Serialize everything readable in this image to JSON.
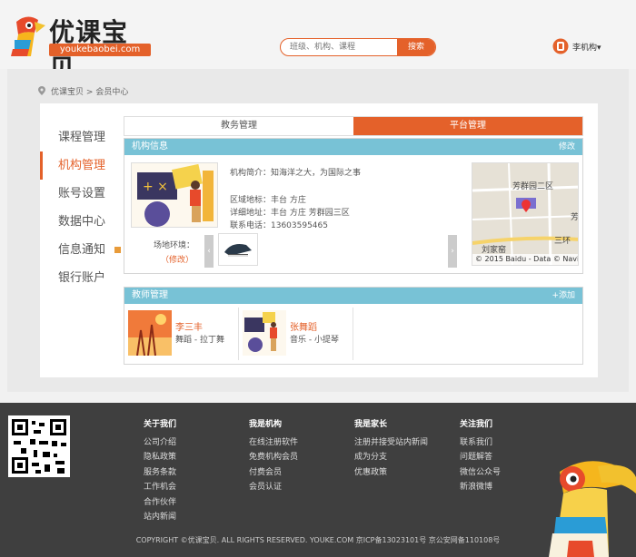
{
  "header": {
    "logo_title": "优课宝贝",
    "logo_subtitle": "youkebaobei.com",
    "search_placeholder": "班级、机构、课程",
    "search_button": "搜索",
    "user_name": "李机构▾"
  },
  "breadcrumb": {
    "home": "优课宝贝",
    "separator": ">",
    "current": "会员中心"
  },
  "sidebar": {
    "items": [
      {
        "label": "课程管理"
      },
      {
        "label": "机构管理"
      },
      {
        "label": "账号设置"
      },
      {
        "label": "数据中心"
      },
      {
        "label": "信息通知"
      },
      {
        "label": "银行账户"
      }
    ],
    "active_index": 1
  },
  "tabs": {
    "items": [
      {
        "label": "教务管理"
      },
      {
        "label": "平台管理"
      }
    ],
    "active_index": 1
  },
  "org_info": {
    "title": "机构信息",
    "edit": "修改",
    "intro": "机构简介：知海洋之大，为国际之事",
    "district": "区域地标：丰台 方庄",
    "address": "详细地址：丰台 方庄 芳群园三区",
    "phone": "联系电话：13603595465",
    "venue_label": "场地环境：",
    "venue_edit": "（修改）",
    "prev": "‹",
    "next": "›",
    "map": {
      "label_area": "芳群园二区",
      "label_fang": "芳",
      "label_liujia": "刘家窑",
      "label_sanhuan": "三环",
      "copyright": "© 2015 Baidu - Data © Navinfo"
    }
  },
  "teachers": {
    "title": "教师管理",
    "add": "+添加",
    "items": [
      {
        "name": "李三丰",
        "desc": "舞蹈 - 拉丁舞"
      },
      {
        "name": "张舞蹈",
        "desc": "音乐 - 小提琴"
      }
    ]
  },
  "footer": {
    "columns": [
      {
        "title": "关于我们",
        "links": [
          "公司介绍",
          "隐私政策",
          "服务条款",
          "工作机会",
          "合作伙伴",
          "站内新闻"
        ]
      },
      {
        "title": "我是机构",
        "links": [
          "在线注册软件",
          "免费机构会员",
          "付费会员",
          "会员认证"
        ]
      },
      {
        "title": "我是家长",
        "links": [
          "注册并接受站内新闻",
          "成为分支",
          "优惠政策"
        ]
      },
      {
        "title": "关注我们",
        "links": [
          "联系我们",
          "问题解答",
          "微信公众号",
          "新浪微博"
        ]
      }
    ],
    "copyright": "COPYRIGHT ©优课宝贝. ALL RIGHTS RESERVED.   YOUKE.COM    京ICP备13023101号 京公安网备110108号"
  },
  "colors": {
    "accent": "#e4612a",
    "section_header": "#78c2d6",
    "footer_bg": "#3f3f3f"
  }
}
